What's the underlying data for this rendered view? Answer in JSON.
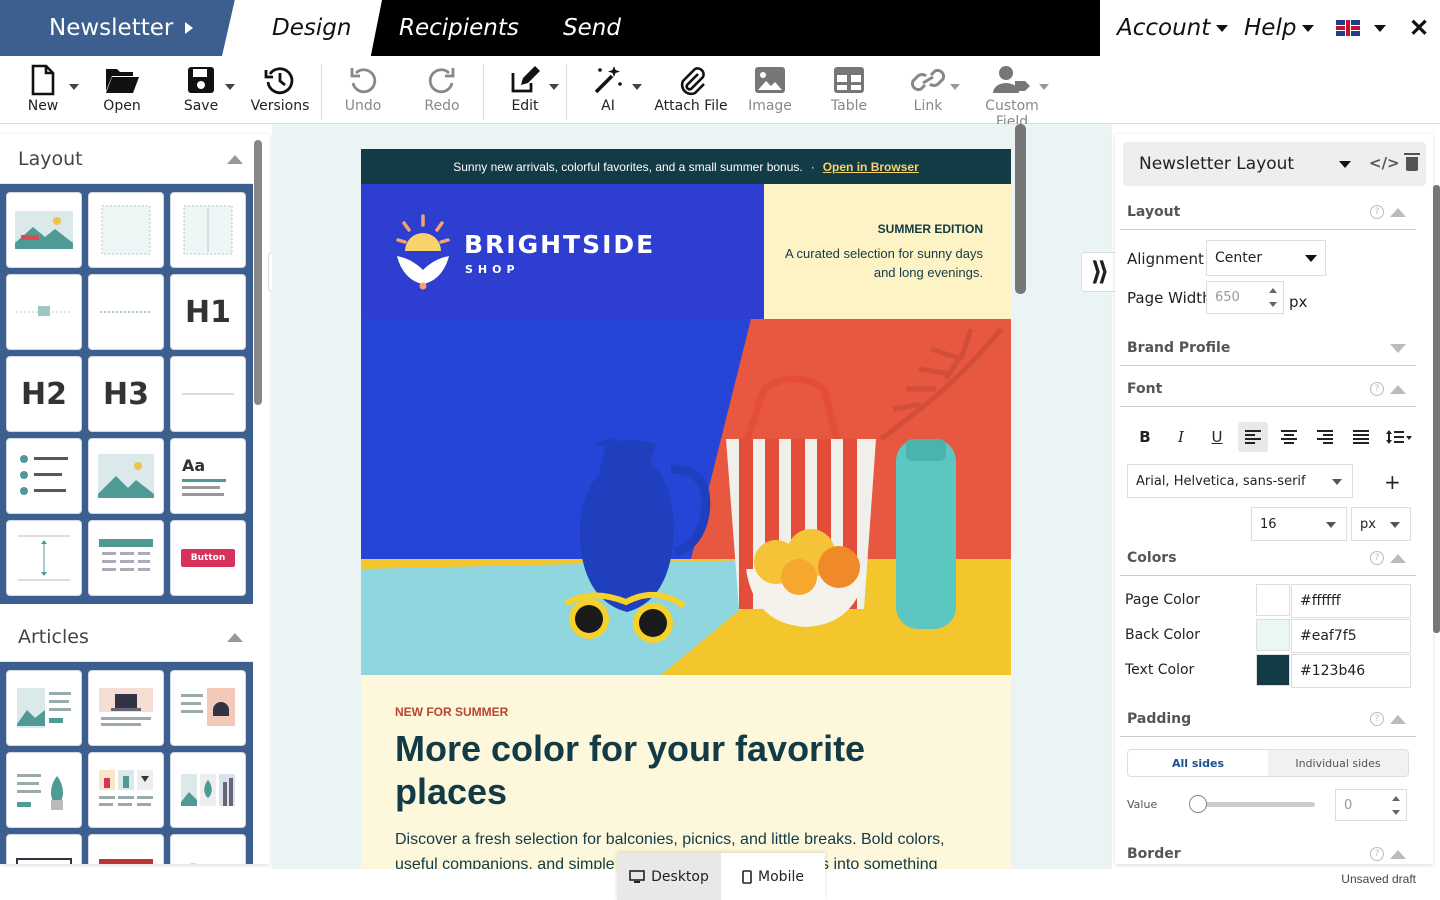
{
  "topnav": {
    "newsletter": "Newsletter",
    "tabs": [
      "Design",
      "Recipients",
      "Send"
    ],
    "account": "Account",
    "help": "Help",
    "close": "✕"
  },
  "toolbar": {
    "new": "New",
    "open": "Open",
    "save": "Save",
    "versions": "Versions",
    "undo": "Undo",
    "redo": "Redo",
    "edit": "Edit",
    "ai": "AI",
    "attach": "Attach File",
    "image": "Image",
    "table": "Table",
    "link": "Link",
    "custom_field": "Custom Field"
  },
  "left": {
    "layout_title": "Layout",
    "articles_title": "Articles",
    "h1": "H1",
    "h2": "H2",
    "h3": "H3",
    "aa": "Aa",
    "button": "Button"
  },
  "email": {
    "preheader": "Sunny new arrivals, colorful favorites, and a small summer bonus.",
    "sep": "·",
    "open_browser": "Open in Browser",
    "brand": "BRIGHTSIDE",
    "brand_sub": "SHOP",
    "edition": "SUMMER EDITION",
    "edition_desc": "A curated selection for sunny days and long evenings.",
    "kicker": "NEW FOR SUMMER",
    "headline": "More color for your favorite places",
    "body": "Discover a fresh selection for balconies, picnics, and little breaks. Bold colors, useful companions, and simple ideas turn everyday moments into something"
  },
  "device": {
    "desktop": "Desktop",
    "mobile": "Mobile"
  },
  "status": "Unsaved draft",
  "right": {
    "template": "Newsletter Layout",
    "code": "</>",
    "layout": "Layout",
    "alignment_label": "Alignment",
    "alignment_value": "Center",
    "page_width_label": "Page Width",
    "page_width_value": "650",
    "px": "px",
    "brand_profile": "Brand Profile",
    "font": "Font",
    "font_family": "Arial, Helvetica, sans-serif",
    "plus": "+",
    "font_size": "16",
    "font_unit": "px",
    "colors": "Colors",
    "page_color_label": "Page Color",
    "page_color": "#ffffff",
    "back_color_label": "Back Color",
    "back_color": "#eaf7f5",
    "text_color_label": "Text Color",
    "text_color": "#123b46",
    "padding": "Padding",
    "all_sides": "All sides",
    "individual_sides": "Individual sides",
    "value_label": "Value",
    "value": "0",
    "padding_value": 0,
    "border": "Border",
    "help_mark": "?"
  },
  "colors": {
    "nav_blue": "#3d5f8f",
    "brand_blue": "#2e3ed0",
    "cream": "#fdf3c4",
    "dark_teal": "#123b46",
    "accent_yellow": "#f6d36b"
  }
}
